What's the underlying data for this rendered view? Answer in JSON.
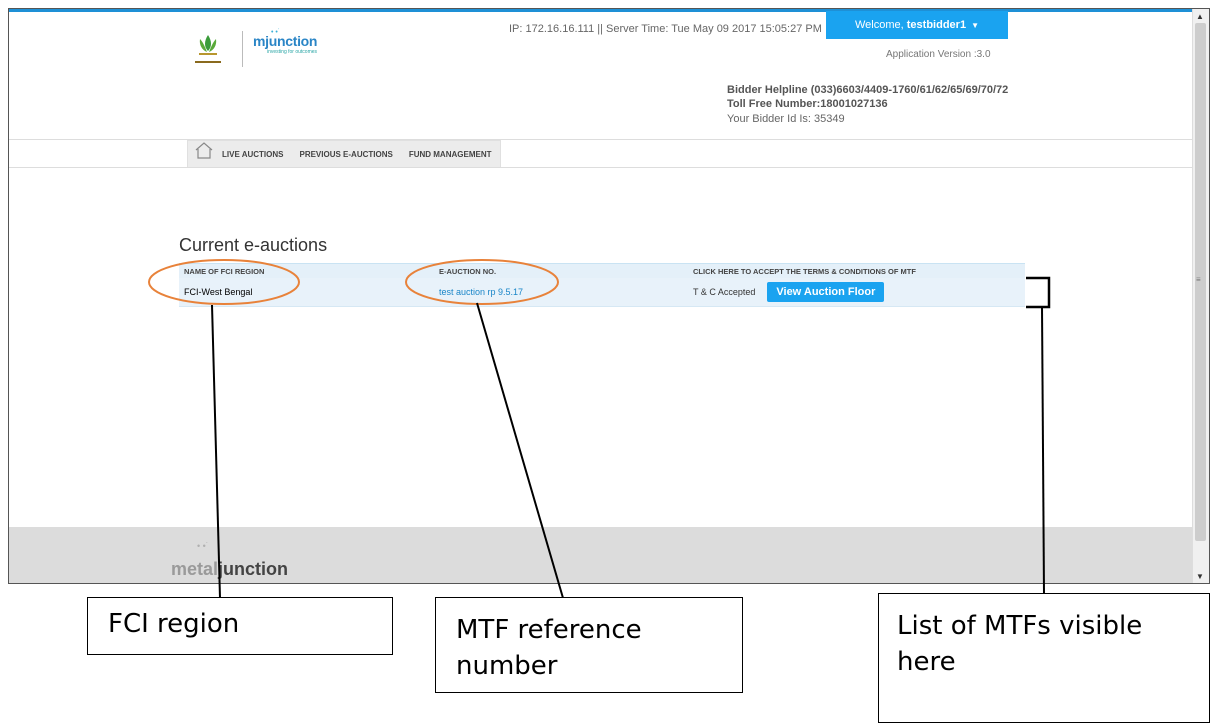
{
  "header": {
    "server_info": "IP: 172.16.16.111 || Server Time: Tue May 09 2017 15:05:27 PM",
    "welcome_prefix": "Welcome,",
    "username": "testbidder1",
    "app_version": "Application Version :3.0",
    "helpline": "Bidder Helpline (033)6603/4409-1760/61/62/65/69/70/72",
    "toll_free": "Toll Free Number:18001027136",
    "bidder_id": "Your Bidder Id Is: 35349",
    "logo_text": "mjunction",
    "logo_tagline": "investing for outcomes"
  },
  "menu": {
    "items": [
      {
        "label": "LIVE AUCTIONS"
      },
      {
        "label": "PREVIOUS E-AUCTIONS"
      },
      {
        "label": "FUND MANAGEMENT"
      }
    ]
  },
  "main": {
    "title": "Current e-auctions",
    "columns": [
      "NAME OF FCI REGION",
      "E-AUCTION NO.",
      "CLICK HERE TO ACCEPT THE TERMS & CONDITIONS OF MTF"
    ],
    "rows": [
      {
        "region": "FCI-West Bengal",
        "auction_no": "test auction rp 9.5.17",
        "tc_status": "T & C Accepted",
        "action_label": "View Auction Floor"
      }
    ]
  },
  "footer": {
    "logo_part1": "metal",
    "logo_part2": "junction"
  },
  "annotations": [
    {
      "text": "FCI region"
    },
    {
      "text": "MTF reference number"
    },
    {
      "text": "List of MTFs visible here"
    }
  ],
  "colors": {
    "accent": "#1aa3f0",
    "link": "#1a86c8",
    "annotation_ellipse": "#e8823a"
  }
}
